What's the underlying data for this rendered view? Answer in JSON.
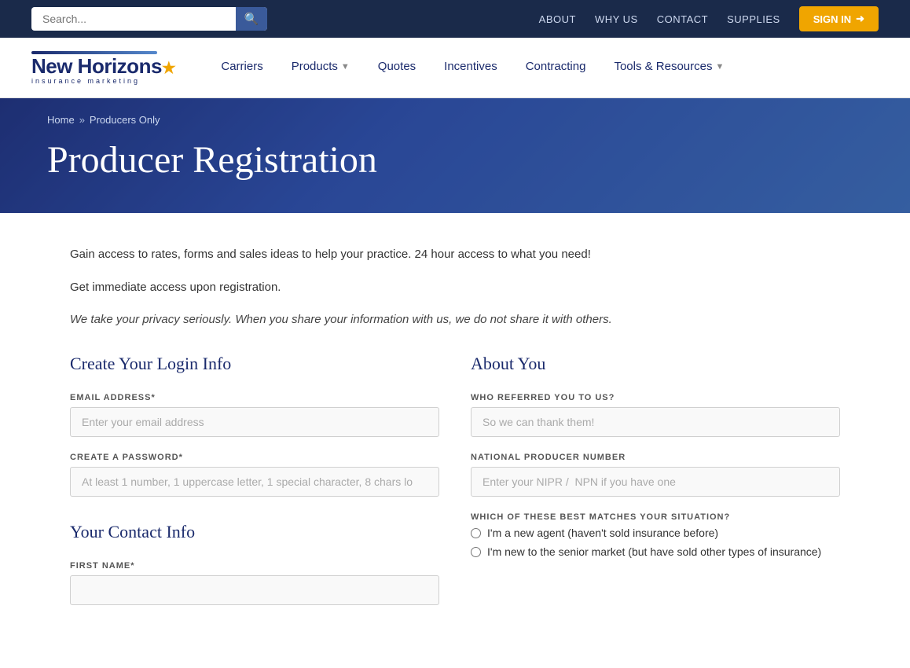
{
  "topbar": {
    "search_placeholder": "Search...",
    "search_icon": "🔍",
    "nav": [
      {
        "label": "ABOUT",
        "href": "#"
      },
      {
        "label": "WHY US",
        "href": "#"
      },
      {
        "label": "CONTACT",
        "href": "#"
      },
      {
        "label": "SUPPLIES",
        "href": "#"
      }
    ],
    "sign_in": "SIGN IN"
  },
  "navbar": {
    "logo": {
      "brand": "New Horizons",
      "star": "★",
      "tagline": "insurance marketing"
    },
    "items": [
      {
        "label": "Carriers",
        "has_dropdown": false
      },
      {
        "label": "Products",
        "has_dropdown": true
      },
      {
        "label": "Quotes",
        "has_dropdown": false
      },
      {
        "label": "Incentives",
        "has_dropdown": false
      },
      {
        "label": "Contracting",
        "has_dropdown": false
      },
      {
        "label": "Tools & Resources",
        "has_dropdown": true
      }
    ]
  },
  "breadcrumb": {
    "home": "Home",
    "sep": "»",
    "current": "Producers Only"
  },
  "hero": {
    "title": "Producer Registration"
  },
  "intro": {
    "line1": "Gain access to rates, forms and sales ideas to help your practice. 24 hour access to what you need!",
    "line2": "Get immediate access upon registration.",
    "privacy": "We take your privacy seriously. When you share your information with us, we do not share it with others."
  },
  "login_section": {
    "heading": "Create Your Login Info",
    "email_label": "EMAIL ADDRESS*",
    "email_placeholder": "Enter your email address",
    "password_label": "CREATE A PASSWORD*",
    "password_placeholder": "At least 1 number, 1 uppercase letter, 1 special character, 8 chars lo"
  },
  "contact_section": {
    "heading": "Your Contact Info",
    "first_name_label": "FIRST NAME*",
    "first_name_placeholder": ""
  },
  "about_section": {
    "heading": "About You",
    "referral_label": "WHO REFERRED YOU TO US?",
    "referral_placeholder": "So we can thank them!",
    "npn_label": "NATIONAL PRODUCER NUMBER",
    "npn_placeholder": "Enter your NIPR /  NPN if you have one",
    "situation_label": "WHICH OF THESE BEST MATCHES YOUR SITUATION?",
    "situations": [
      "I'm a new agent (haven't sold insurance before)",
      "I'm new to the senior market (but have sold other types of insurance)"
    ]
  }
}
